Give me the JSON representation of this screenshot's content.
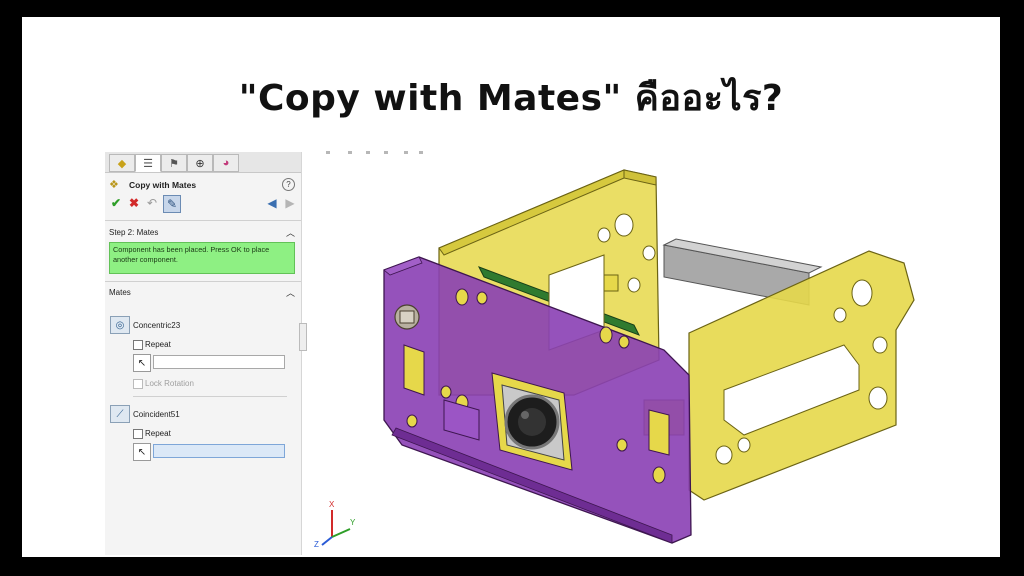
{
  "page": {
    "title": "\"Copy with Mates\" คืออะไร?"
  },
  "tabs": [
    {
      "icon": "feature-manager-icon",
      "active": false
    },
    {
      "icon": "property-manager-icon",
      "active": true
    },
    {
      "icon": "configuration-manager-icon",
      "active": false
    },
    {
      "icon": "dimxpert-icon",
      "active": false
    },
    {
      "icon": "display-manager-icon",
      "active": false
    }
  ],
  "property_manager": {
    "title": "Copy with Mates",
    "help_label": "?",
    "step_heading": "Step 2: Mates",
    "message": "Component has been placed. Press OK to place another component.",
    "mates_heading": "Mates",
    "mates": [
      {
        "name": "Concentric23",
        "icon": "concentric-mate-icon",
        "repeat_label": "Repeat",
        "repeat_checked": false,
        "field_value": "",
        "lock_rotation_label": "Lock Rotation",
        "lock_rotation_enabled": false
      },
      {
        "name": "Coincident51",
        "icon": "coincident-mate-icon",
        "repeat_label": "Repeat",
        "repeat_checked": false,
        "field_value": ""
      }
    ]
  },
  "triad": {
    "x_label": "X",
    "y_label": "Y",
    "z_label": "Z"
  },
  "colors": {
    "ok": "#2e9e28",
    "cancel": "#d22a2a",
    "message_bg": "#8ef083",
    "part_yellow": "#e6d84a",
    "part_purple": "#8a3fb4",
    "shaft": "#a9a9a9",
    "pcb": "#2f7a2f"
  }
}
